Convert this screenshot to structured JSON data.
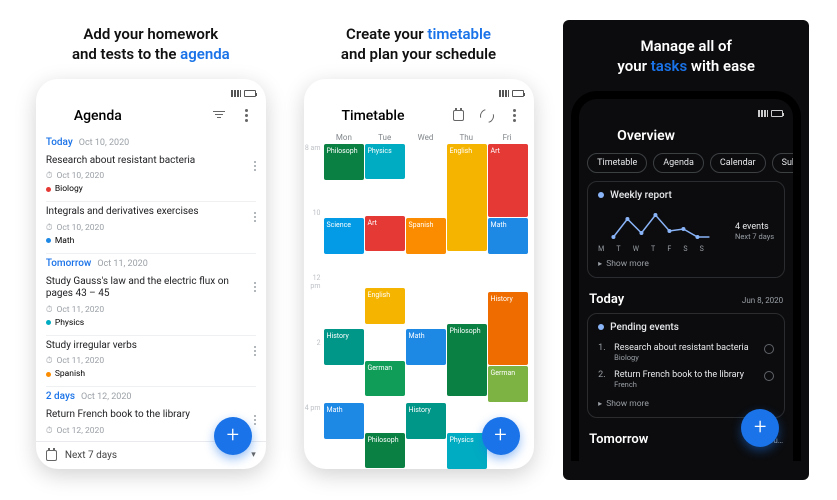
{
  "captions": {
    "agenda": {
      "line1": "Add your homework",
      "line2_a": "and tests to the ",
      "line2_b": "agenda"
    },
    "timetable": {
      "line1_a": "Create your ",
      "line1_b": "timetable",
      "line2": "and plan your schedule"
    },
    "overview": {
      "line1": "Manage all of",
      "line2_a": "your ",
      "line2_b": "tasks",
      "line2_c": " with ease"
    }
  },
  "agenda": {
    "title": "Agenda",
    "bottom_label": "Next 7 days",
    "groups": [
      {
        "label": "Today",
        "date": "Oct 10, 2020",
        "tasks": [
          {
            "title": "Research about resistant bacteria",
            "due": "Oct 10, 2020",
            "subject": "Biology",
            "color": "#e53935"
          },
          {
            "title": "Integrals and derivatives exercises",
            "due": "Oct 10, 2020",
            "subject": "Math",
            "color": "#1e88e5"
          }
        ]
      },
      {
        "label": "Tomorrow",
        "date": "Oct 11, 2020",
        "tasks": [
          {
            "title": "Study Gauss's law and the electric flux on pages 43 – 45",
            "due": "Oct 11, 2020",
            "subject": "Physics",
            "color": "#00acc1"
          },
          {
            "title": "Study irregular verbs",
            "due": "Oct 11, 2020",
            "subject": "Spanish",
            "color": "#fb8c00"
          }
        ]
      },
      {
        "label": "2 days",
        "date": "Oct 12, 2020",
        "tasks": [
          {
            "title": "Return French book to the library",
            "due": "Oct 12, 2020",
            "subject": "",
            "color": ""
          }
        ]
      }
    ]
  },
  "timetable": {
    "title": "Timetable",
    "days": [
      "Mon",
      "Tue",
      "Wed",
      "Thu",
      "Fri"
    ],
    "hours": [
      "8 am",
      "",
      "10",
      "",
      "12 pm",
      "",
      "2",
      "",
      "4 pm",
      ""
    ],
    "cols": [
      [
        {
          "t": "Philosoph",
          "c": "#0b8043",
          "h": 1
        },
        {
          "t": "",
          "c": "transparent",
          "h": 1
        },
        {
          "t": "Science",
          "c": "#039be5",
          "h": 1
        },
        {
          "t": "",
          "c": "transparent",
          "h": 2
        },
        {
          "t": "History",
          "c": "#009688",
          "h": 1
        },
        {
          "t": "",
          "c": "transparent",
          "h": 1
        },
        {
          "t": "Math",
          "c": "#1e88e5",
          "h": 1
        }
      ],
      [
        {
          "t": "Physics",
          "c": "#00acc1",
          "h": 1
        },
        {
          "t": "",
          "c": "transparent",
          "h": 1
        },
        {
          "t": "Art",
          "c": "#e53935",
          "h": 1
        },
        {
          "t": "",
          "c": "transparent",
          "h": 1
        },
        {
          "t": "English",
          "c": "#f4b400",
          "h": 1
        },
        {
          "t": "",
          "c": "transparent",
          "h": 1
        },
        {
          "t": "German",
          "c": "#0f9d58",
          "h": 1
        },
        {
          "t": "",
          "c": "transparent",
          "h": 1
        },
        {
          "t": "Philosoph",
          "c": "#0b8043",
          "h": 1
        }
      ],
      [
        {
          "t": "",
          "c": "transparent",
          "h": 2
        },
        {
          "t": "Spanish",
          "c": "#fb8c00",
          "h": 1
        },
        {
          "t": "",
          "c": "transparent",
          "h": 2
        },
        {
          "t": "Math",
          "c": "#1e88e5",
          "h": 1
        },
        {
          "t": "",
          "c": "transparent",
          "h": 1
        },
        {
          "t": "History",
          "c": "#009688",
          "h": 1
        }
      ],
      [
        {
          "t": "English",
          "c": "#f4b400",
          "h": 3
        },
        {
          "t": "",
          "c": "transparent",
          "h": 2
        },
        {
          "t": "Philosoph",
          "c": "#0b8043",
          "h": 2
        },
        {
          "t": "",
          "c": "transparent",
          "h": 1
        },
        {
          "t": "Physics",
          "c": "#00acc1",
          "h": 1
        }
      ],
      [
        {
          "t": "Art",
          "c": "#e53935",
          "h": 2
        },
        {
          "t": "Math",
          "c": "#1e88e5",
          "h": 1
        },
        {
          "t": "",
          "c": "transparent",
          "h": 1
        },
        {
          "t": "History",
          "c": "#ef6c00",
          "h": 2
        },
        {
          "t": "German",
          "c": "#7cb342",
          "h": 1
        }
      ]
    ]
  },
  "overview": {
    "title": "Overview",
    "chips": [
      "Timetable",
      "Agenda",
      "Calendar",
      "Sub"
    ],
    "report": {
      "title": "Weekly report",
      "events_n": "4 events",
      "events_sub": "Next 7 days",
      "days": [
        "M",
        "T",
        "W",
        "T",
        "F",
        "S",
        "S"
      ],
      "showmore": "Show more"
    },
    "today": {
      "label": "Today",
      "date": "Jun 8, 2020",
      "pending_title": "Pending events",
      "items": [
        {
          "n": "1.",
          "title": "Research about resistant bacteria",
          "sub": "Biology"
        },
        {
          "n": "2.",
          "title": "Return French book to the library",
          "sub": "French"
        }
      ],
      "showmore": "Show more"
    },
    "tomorrow_label": "Tomorrow"
  }
}
